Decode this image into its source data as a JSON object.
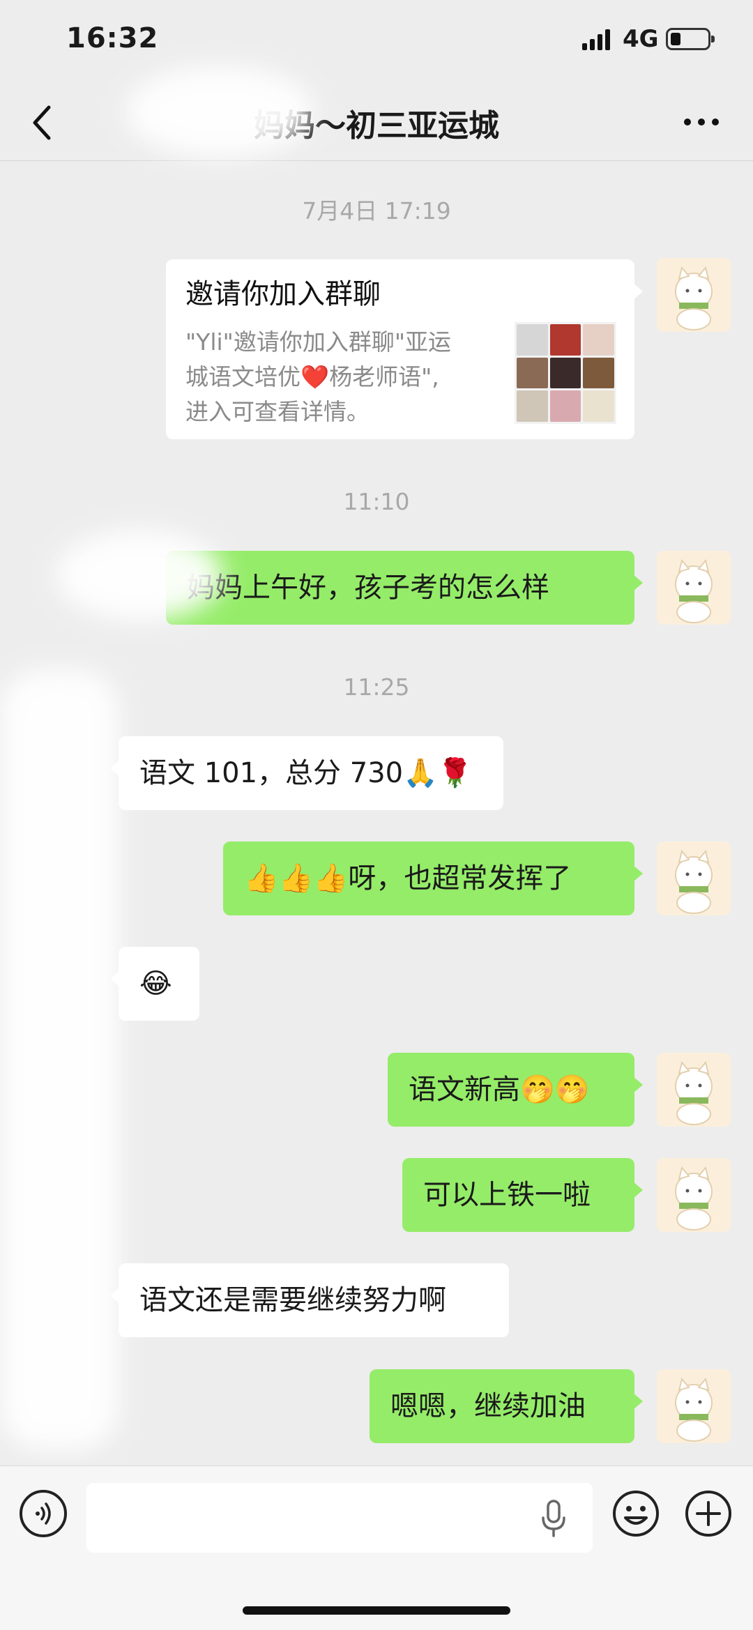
{
  "status_bar": {
    "time": "16:32",
    "network": "4G",
    "battery_level": 0.2
  },
  "nav": {
    "title": "妈妈～初三亚运城",
    "back_icon": "chevron-left-icon",
    "more_icon": "more-dots-icon"
  },
  "messages": [
    {
      "type": "timestamp",
      "text": "7月4日 17:19"
    },
    {
      "type": "invite",
      "sender": "me",
      "title": "邀请你加入群聊",
      "description": "\"Yli\"邀请你加入群聊\"亚运\n城语文培优❤️杨老师语\",\n进入可查看详情。"
    },
    {
      "type": "timestamp",
      "text": "11:10"
    },
    {
      "type": "text",
      "sender": "me",
      "text": "妈妈上午好，孩子考的怎么样"
    },
    {
      "type": "timestamp",
      "text": "11:25"
    },
    {
      "type": "text",
      "sender": "them",
      "text": "语文 101，总分 730🙏🌹"
    },
    {
      "type": "text",
      "sender": "me",
      "text": "👍👍👍呀，也超常发挥了"
    },
    {
      "type": "text",
      "sender": "them",
      "text": "😂"
    },
    {
      "type": "text",
      "sender": "me",
      "text": "语文新高🤭🤭"
    },
    {
      "type": "text",
      "sender": "me",
      "text": "可以上铁一啦"
    },
    {
      "type": "text",
      "sender": "them",
      "text": "语文还是需要继续努力啊"
    },
    {
      "type": "text",
      "sender": "me",
      "text": "嗯嗯，继续加油"
    }
  ],
  "input_bar": {
    "input_value": "",
    "voice_icon": "voice-mode-icon",
    "mic_icon": "microphone-icon",
    "emoji_icon": "emoji-icon",
    "plus_icon": "plus-circle-icon"
  },
  "colors": {
    "background": "#ededed",
    "my_bubble": "#95ec69",
    "their_bubble": "#ffffff",
    "timestamp": "#a8a8a8"
  }
}
